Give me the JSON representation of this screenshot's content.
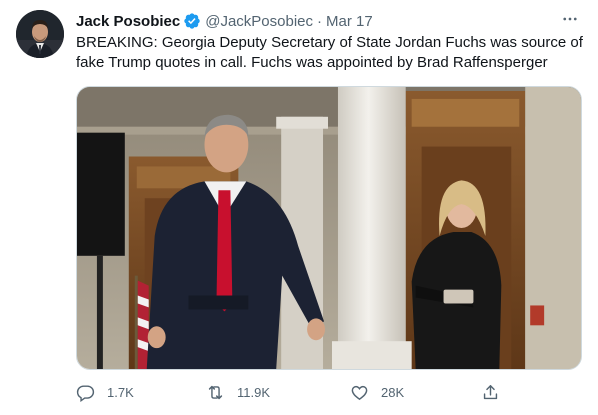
{
  "tweet": {
    "author": {
      "display_name": "Jack Posobiec",
      "handle": "@JackPosobiec",
      "verified_icon": "verified-badge-icon"
    },
    "separator": "·",
    "date": "Mar 17",
    "more_icon": "more-horizontal-icon",
    "text_line1": "BREAKING: Georgia Deputy Secretary of State Jordan Fuchs was source of",
    "text_line2": "fake Trump quotes in call. Fuchs was appointed by Brad Raffensperger",
    "media": {
      "description_icon": "photo",
      "colors": {
        "pillar": "#e9e6df",
        "wood": "#7a4a25",
        "suit": "#1c2233",
        "tie": "#c8102e"
      }
    },
    "actions": {
      "reply": {
        "icon": "reply-icon",
        "count": "1.7K"
      },
      "retweet": {
        "icon": "retweet-icon",
        "count": "11.9K"
      },
      "like": {
        "icon": "heart-icon",
        "count": "28K"
      },
      "share": {
        "icon": "share-icon"
      }
    },
    "colors": {
      "verified": "#1d9bf0",
      "secondary_text": "#536471"
    }
  }
}
